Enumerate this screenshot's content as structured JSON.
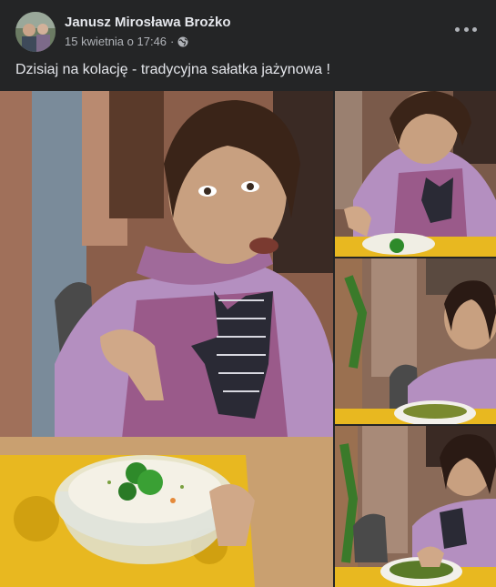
{
  "post": {
    "author": "Janusz Mirosława Brożko",
    "timestamp": "15 kwietnia o 17:46",
    "separator": "·",
    "caption": "Dzisiaj na kolację - tradycyjna sałatka jażynowa !"
  },
  "icons": {
    "privacy": "globe-icon",
    "menu": "more-options-icon"
  },
  "colors": {
    "background": "#242526",
    "primary_text": "#e4e6eb",
    "secondary_text": "#b0b3b8"
  }
}
